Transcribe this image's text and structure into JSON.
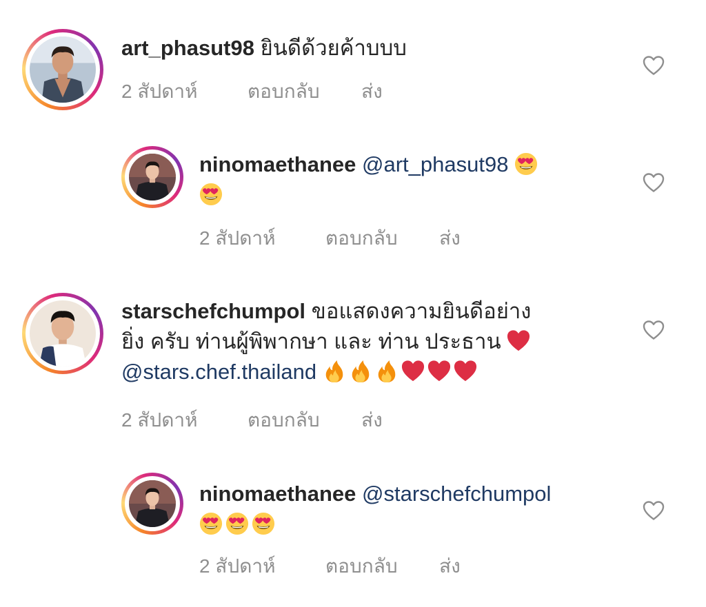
{
  "comments": [
    {
      "username": "art_phasut98",
      "text": " ยินดีด้วยค้าบบบ",
      "time": "2 สัปดาห์",
      "reply_label": "ตอบกลับ",
      "send_label": "ส่ง"
    },
    {
      "username": "ninomaethanee",
      "mention": "@art_phasut98",
      "time": "2 สัปดาห์",
      "reply_label": "ตอบกลับ",
      "send_label": "ส่ง"
    },
    {
      "username": "starschefchumpol",
      "text_line1": " ขอแสดงความยินดีอย่าง",
      "text_line2": "ยิ่ง ครับ  ท่านผู้พิพากษา และ ท่าน ประธาน ",
      "mention": "@stars.chef.thailand",
      "time": "2 สัปดาห์",
      "reply_label": "ตอบกลับ",
      "send_label": "ส่ง"
    },
    {
      "username": "ninomaethanee",
      "mention": "@starschefchumpol",
      "time": "2 สัปดาห์",
      "reply_label": "ตอบกลับ",
      "send_label": "ส่ง"
    }
  ],
  "icons": {
    "like": "heart-outline-icon",
    "emoji_love": "heart-eyes-emoji",
    "emoji_heart": "red-heart-emoji",
    "emoji_fire": "fire-emoji"
  },
  "colors": {
    "text": "#262626",
    "meta": "#8e8e8e",
    "mention": "#1f3a63",
    "ring_start": "#f58529",
    "ring_end": "#dd2a7b"
  }
}
